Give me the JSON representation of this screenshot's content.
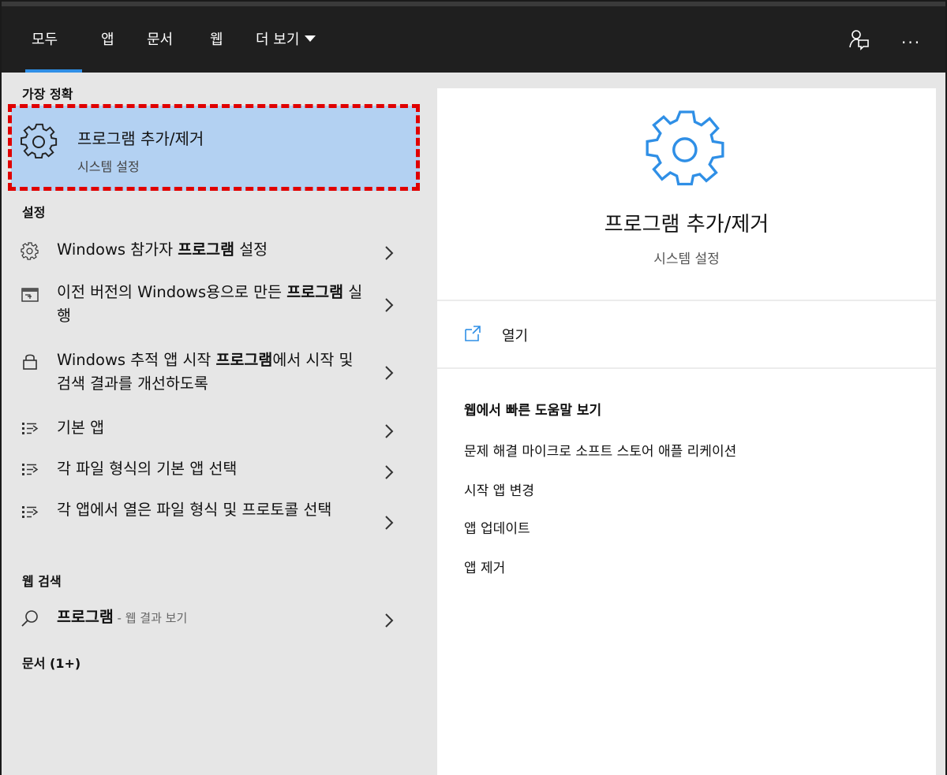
{
  "topbar": {
    "tabs": [
      {
        "label": "모두",
        "active": true
      },
      {
        "label": "앱",
        "active": false
      },
      {
        "label": "문서",
        "active": false
      },
      {
        "label": "웹",
        "active": false
      },
      {
        "label": "더 보기",
        "active": false
      }
    ],
    "feedback_icon": "feedback-person-icon",
    "more_options": "···"
  },
  "left": {
    "best_match_header": "가장 정확",
    "best_match": {
      "icon": "gear-icon",
      "title": "프로그램 추가/제거",
      "subtitle": "시스템 설정",
      "highlight_color": "#b3d1f2",
      "annotation_color": "#e00000"
    },
    "settings_header": "설정",
    "settings_items": [
      {
        "icon": "gear-icon",
        "pre": "Windows 참가자 ",
        "bold": "프로그램",
        "post": " 설정"
      },
      {
        "icon": "window-compat-icon",
        "pre": "이전 버전의 Windows용으로 만든 ",
        "bold": "프로그램",
        "post": " 실행"
      },
      {
        "icon": "lock-icon",
        "pre": "Windows 추적 앱 시작 ",
        "bold": "프로그램",
        "post": "에서 시작 및 검색 결과를 개선하도록"
      },
      {
        "icon": "list-icon",
        "pre": "기본 앱",
        "bold": "",
        "post": ""
      },
      {
        "icon": "list-icon",
        "pre": "각 파일 형식의 기본 앱 선택",
        "bold": "",
        "post": ""
      },
      {
        "icon": "list-icon",
        "pre": "각 앱에서 열은 파일 형식 및 프로토콜 선택",
        "bold": "",
        "post": ""
      }
    ],
    "web_header": "웹 검색",
    "web_item": {
      "icon": "search-icon",
      "term": "프로그램",
      "suffix": " - 웹 결과 보기"
    },
    "docs_header": "문서 (1+)"
  },
  "right": {
    "icon": "gear-icon",
    "accent": "#2f8fe6",
    "title": "프로그램 추가/제거",
    "subtitle": "시스템 설정",
    "open_label": "열기",
    "open_icon": "open-external-icon",
    "web_help_header": "웹에서 빠른 도움말 보기",
    "web_links": [
      "문제 해결 마이크로 소프트 스토어 애플 리케이션",
      "시작 앱 변경",
      "앱 업데이트",
      "앱 제거"
    ]
  }
}
